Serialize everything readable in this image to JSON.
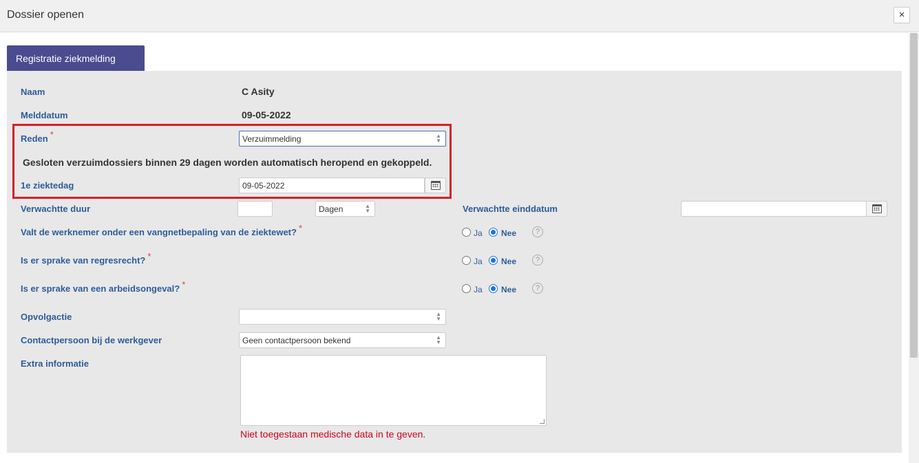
{
  "dialog": {
    "title": "Dossier openen",
    "close_label": "×"
  },
  "tab": {
    "label": "Registratie ziekmelding"
  },
  "form": {
    "naam": {
      "label": "Naam",
      "value": "C Asity"
    },
    "melddatum": {
      "label": "Melddatum",
      "value": "09-05-2022"
    },
    "reden": {
      "label": "Reden",
      "required": "*",
      "value": "Verzuimmelding"
    },
    "notice": "Gesloten verzuimdossiers binnen 29 dagen worden automatisch heropend en gekoppeld.",
    "ziektedag": {
      "label": "1e ziektedag",
      "value": "09-05-2022"
    },
    "duur": {
      "label": "Verwachtte duur",
      "value": "",
      "unit": "Dagen"
    },
    "einddatum": {
      "label": "Verwachtte einddatum",
      "value": ""
    },
    "vangnet": {
      "label": "Valt de werknemer onder een vangnetbepaling van de ziektewet?",
      "required": "*",
      "ja": "Ja",
      "nee": "Nee",
      "selected": "Nee"
    },
    "regres": {
      "label": "Is er sprake van regresrecht?",
      "required": "*",
      "ja": "Ja",
      "nee": "Nee",
      "selected": "Nee"
    },
    "arbeidsongeval": {
      "label": "Is er sprake van een arbeidsongeval?",
      "required": "*",
      "ja": "Ja",
      "nee": "Nee",
      "selected": "Nee"
    },
    "opvolgactie": {
      "label": "Opvolgactie",
      "value": ""
    },
    "contactpersoon": {
      "label": "Contactpersoon bij de werkgever",
      "value": "Geen contactpersoon bekend"
    },
    "extra": {
      "label": "Extra informatie",
      "value": "",
      "warning": "Niet toegestaan medische data in te geven."
    }
  },
  "icons": {
    "help": "?",
    "calendar": "calendar-icon",
    "close": "close-icon"
  },
  "colors": {
    "tab": "#4b4b8f",
    "label": "#2e5c99",
    "required": "#e04040",
    "warning": "#d0021b",
    "highlight": "#d81f26",
    "radio": "#1a73e8"
  }
}
